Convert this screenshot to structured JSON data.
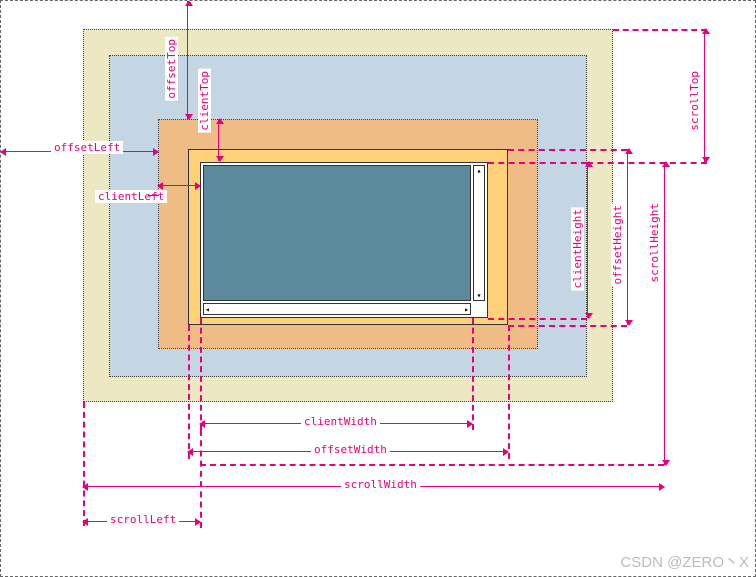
{
  "labels": {
    "offsetTop": "offsetTop",
    "clientTop": "clientTop",
    "offsetLeft": "offsetLeft",
    "clientLeft": "clientLeft",
    "clientHeight": "clientHeight",
    "offsetHeight": "offsetHeight",
    "scrollHeight": "scrollHeight",
    "scrollTop": "scrollTop",
    "clientWidth": "clientWidth",
    "offsetWidth": "offsetWidth",
    "scrollWidth": "scrollWidth",
    "scrollLeft": "scrollLeft"
  },
  "colors": {
    "magenta": "#e6007e",
    "outerYellow": "#ebe8c2",
    "midBlue": "#c4d6e4",
    "orange": "#f0bc85",
    "innerYellow": "#ffd27a",
    "contentFill": "#5a8a9c"
  },
  "watermark": "CSDN @ZERO丶X"
}
